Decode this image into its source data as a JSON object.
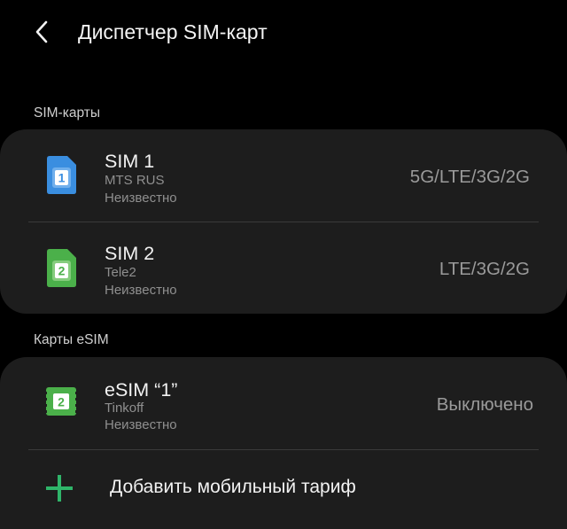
{
  "header": {
    "title": "Диспетчер SIM-карт",
    "back_icon": "chevron-left-icon"
  },
  "sections": {
    "sim_cards_title": "SIM-карты",
    "esim_title": "Карты eSIM"
  },
  "sims": [
    {
      "name": "SIM 1",
      "operator": "MTS RUS",
      "number": "Неизвестно",
      "network": "5G/LTE/3G/2G",
      "icon": "sim-card-1-icon",
      "icon_number": "1",
      "color": "#3a8ee0"
    },
    {
      "name": "SIM 2",
      "operator": "Tele2",
      "number": "Неизвестно",
      "network": "LTE/3G/2G",
      "icon": "sim-card-2-icon",
      "icon_number": "2",
      "color": "#4bb04a"
    }
  ],
  "esims": [
    {
      "name": "eSIM “1”",
      "operator": "Tinkoff",
      "number": "Неизвестно",
      "status": "Выключено",
      "icon": "esim-chip-icon",
      "icon_number": "2",
      "color": "#4bb04a"
    }
  ],
  "add_plan": {
    "label": "Добавить мобильный тариф",
    "icon": "plus-icon",
    "color": "#2fb56a"
  }
}
